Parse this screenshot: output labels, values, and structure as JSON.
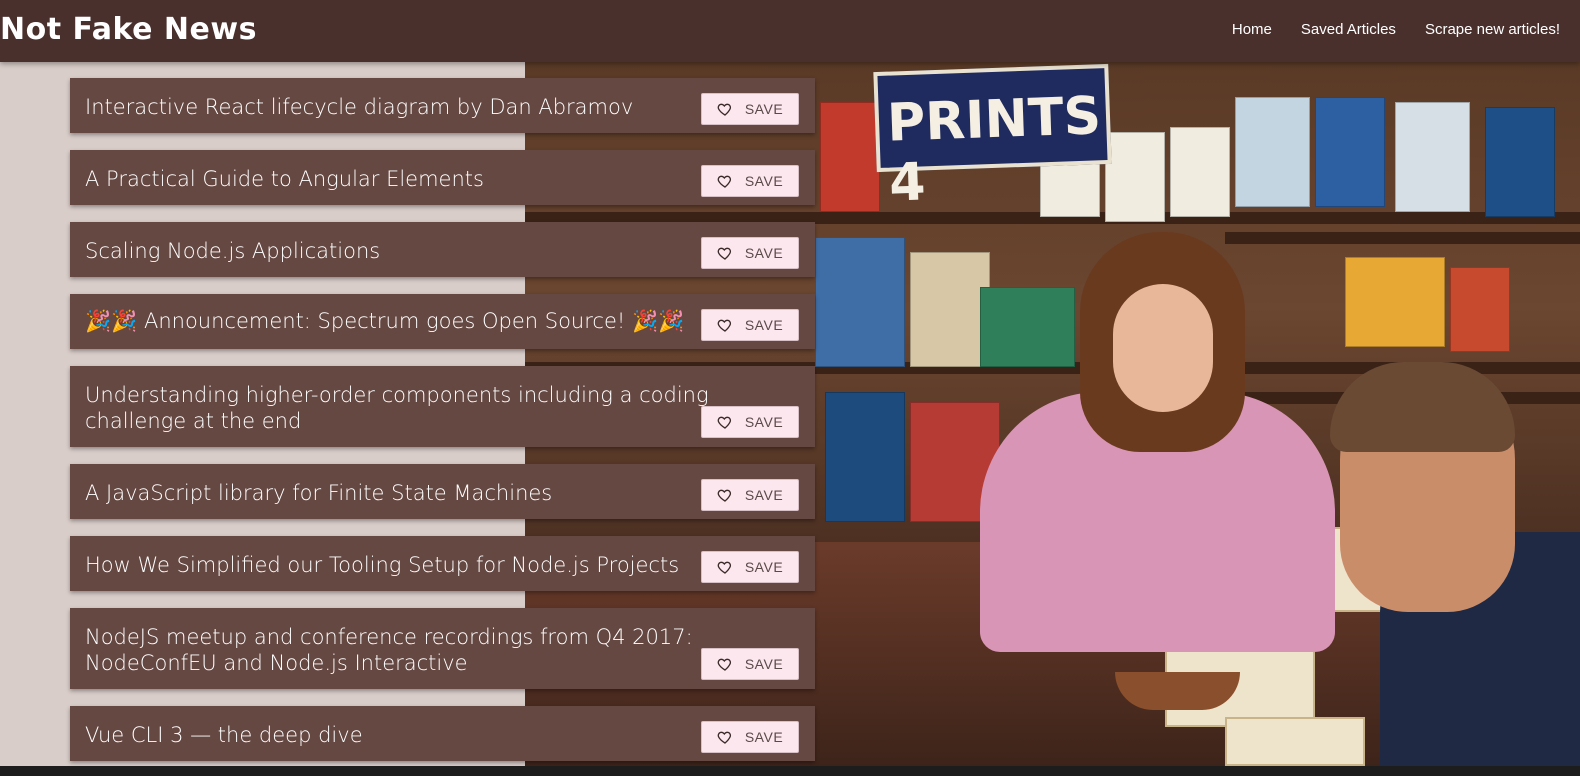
{
  "header": {
    "brand": "Not Fake News",
    "nav": [
      {
        "label": "Home"
      },
      {
        "label": "Saved Articles"
      },
      {
        "label": "Scrape new articles!"
      }
    ]
  },
  "photo": {
    "sign_text": "PRINTS 4"
  },
  "articles": [
    {
      "title": "Interactive React lifecycle diagram by Dan Abramov",
      "save_label": "SAVE"
    },
    {
      "title": "A Practical Guide to Angular Elements",
      "save_label": "SAVE"
    },
    {
      "title": "Scaling Node.js Applications",
      "save_label": "SAVE"
    },
    {
      "title": "🎉🎉 Announcement: Spectrum goes Open Source! 🎉🎉",
      "save_label": "SAVE"
    },
    {
      "title": "Understanding higher-order components including a coding challenge at the end",
      "save_label": "SAVE"
    },
    {
      "title": "A JavaScript library for Finite State Machines",
      "save_label": "SAVE"
    },
    {
      "title": "How We Simplified our Tooling Setup for Node.js Projects",
      "save_label": "SAVE"
    },
    {
      "title": "NodeJS meetup and conference recordings from Q4 2017: NodeConfEU and Node.js Interactive",
      "save_label": "SAVE"
    },
    {
      "title": "Vue CLI 3 — the deep dive",
      "save_label": "SAVE"
    }
  ],
  "colors": {
    "navbar": "#4a302d",
    "article_card": "#654842",
    "save_button": "#fde7ee",
    "page_background": "#d9cdc9"
  }
}
